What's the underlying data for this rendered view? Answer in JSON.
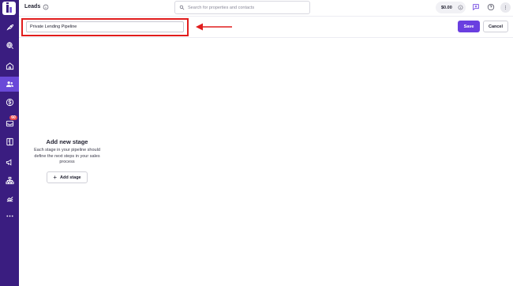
{
  "header": {
    "title": "Leads",
    "search_placeholder": "Search for properties and contacts",
    "balance": "$0.00"
  },
  "sidebar": {
    "badge_count": "60",
    "items": [
      {
        "icon": "rocket-icon"
      },
      {
        "icon": "globe-search-icon"
      },
      {
        "icon": "home-icon"
      },
      {
        "icon": "users-icon",
        "active": true
      },
      {
        "icon": "dollar-icon"
      },
      {
        "icon": "inbox-icon"
      },
      {
        "icon": "document-icon"
      },
      {
        "icon": "megaphone-icon"
      },
      {
        "icon": "org-chart-icon"
      },
      {
        "icon": "analytics-icon"
      },
      {
        "icon": "more-icon"
      }
    ]
  },
  "pipeline": {
    "name_value": "Private Lending Pipeline",
    "save_label": "Save",
    "cancel_label": "Cancel"
  },
  "empty_stage": {
    "title": "Add new stage",
    "description": "Each stage in your pipeline should define the next steps in your sales process",
    "add_label": "Add stage"
  },
  "colors": {
    "sidebar_bg": "#3a1d80",
    "active_item": "#6a49d8",
    "primary_button": "#6a3fe0",
    "annotation_red": "#e11d1d"
  }
}
